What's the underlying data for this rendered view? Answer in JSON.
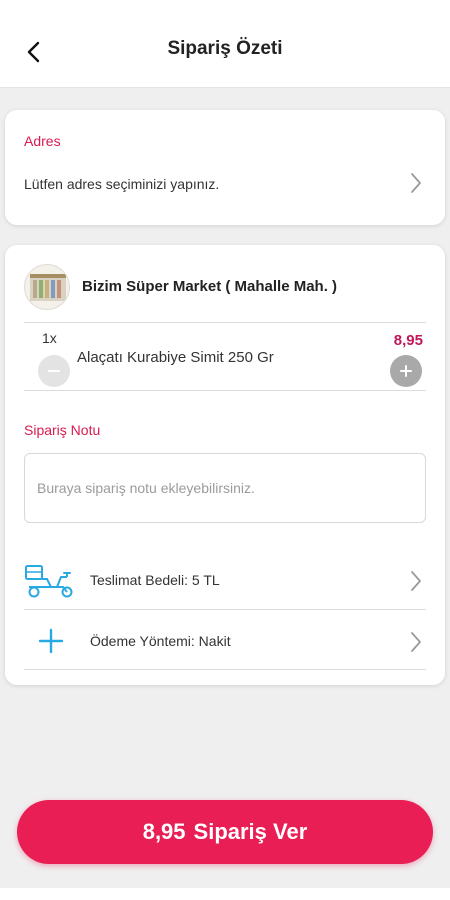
{
  "header": {
    "title": "Sipariş Özeti"
  },
  "address": {
    "label": "Adres",
    "prompt": "Lütfen adres seçiminizi yapınız."
  },
  "store": {
    "name": "Bizim Süper Market ( Mahalle Mah. )"
  },
  "cart": {
    "items": [
      {
        "quantity": "1x",
        "name": "Alaçatı Kurabiye Simit 250 Gr",
        "price": "8,95"
      }
    ]
  },
  "order_note": {
    "label": "Sipariş Notu",
    "placeholder": "Buraya sipariş notu ekleyebilirsiniz."
  },
  "delivery": {
    "label": "Teslimat Bedeli: 5 TL",
    "icon": "scooter-delivery-icon"
  },
  "payment": {
    "label": "Ödeme Yöntemi: Nakit",
    "icon": "plus-icon"
  },
  "footer": {
    "total": "8,95",
    "action_label": "Sipariş Ver"
  },
  "colors": {
    "accent": "#e91e55",
    "label_red": "#d81b50",
    "icon_blue": "#29a9e1"
  }
}
